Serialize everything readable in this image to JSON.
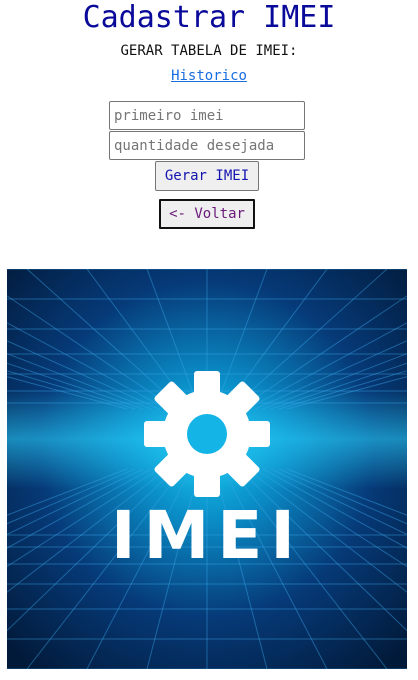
{
  "header": {
    "title": "Cadastrar IMEI",
    "subtitle": "GERAR TABELA DE IMEI:",
    "history_link": "Historico"
  },
  "form": {
    "first_imei_placeholder": "primeiro imei",
    "quantity_placeholder": "quantidade desejada",
    "generate_button": "Gerar IMEI",
    "back_button": "<- Voltar"
  },
  "banner": {
    "text": "IMEI",
    "icon": "gear-icon",
    "colors": {
      "bg_dark": "#021a3a",
      "glow": "#19c8f0",
      "grid": "#2a8fd0"
    }
  }
}
